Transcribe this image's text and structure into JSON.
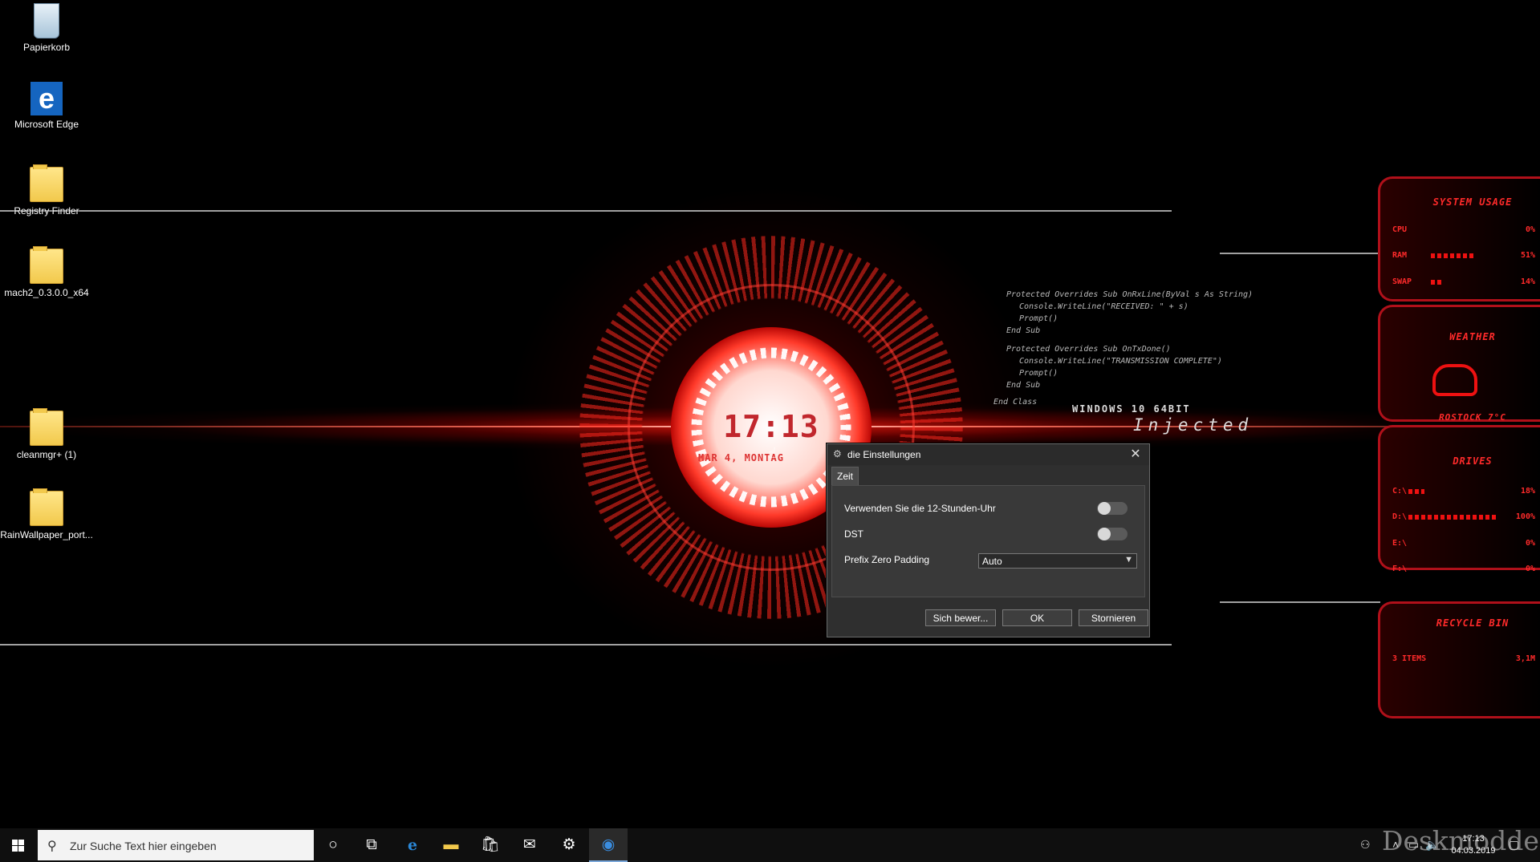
{
  "desktop": {
    "icons": [
      {
        "label": "Papierkorb"
      },
      {
        "label": "Microsoft Edge"
      },
      {
        "label": "Registry Finder"
      },
      {
        "label": "mach2_0.3.0.0_x64"
      },
      {
        "label": "cleanmgr+ (1)"
      },
      {
        "label": "RainWallpaper_port..."
      }
    ]
  },
  "wallpaper": {
    "clock_time": "17:13",
    "clock_date": "MAR 4, MONTAG",
    "os_label": "WINDOWS 10 64BIT",
    "os_sub": "Injected",
    "code_lines": [
      "Protected Overrides Sub OnRxLine(ByVal s As String)",
      "Console.WriteLine(\"RECEIVED: \" + s)",
      "Prompt()",
      "End Sub",
      "Protected Overrides Sub OnTxDone()",
      "Console.WriteLine(\"TRANSMISSION COMPLETE\")",
      "Prompt()",
      "End Sub",
      "End Class"
    ]
  },
  "rainmeter": {
    "system_title": "SYSTEM USAGE",
    "cpu_label": "CPU",
    "cpu_value": "0%",
    "ram_label": "RAM",
    "ram_value": "51%",
    "ram_fraction": 0.51,
    "swap_label": "SWAP",
    "swap_value": "14%",
    "swap_fraction": 0.14,
    "weather_title": "WEATHER",
    "weather_city": "ROSTOCK 7°C",
    "drives_title": "DRIVES",
    "drives": [
      {
        "label": "C:\\",
        "value": "18%",
        "fraction": 0.18
      },
      {
        "label": "D:\\",
        "value": "100%",
        "fraction": 1.0
      },
      {
        "label": "E:\\",
        "value": "0%",
        "fraction": 0
      },
      {
        "label": "F:\\",
        "value": "0%",
        "fraction": 0
      }
    ],
    "recycle_title": "RECYCLE BIN",
    "recycle_items": "3 ITEMS",
    "recycle_size": "3,1M"
  },
  "dialog": {
    "title": "die Einstellungen",
    "tab": "Zeit",
    "option_12h": "Verwenden Sie die 12-Stunden-Uhr",
    "option_12h_on": false,
    "option_dst": "DST",
    "option_dst_on": false,
    "padding_label": "Prefix Zero Padding",
    "padding_value": "Auto",
    "btn_rate": "Sich bewer...",
    "btn_ok": "OK",
    "btn_cancel": "Stornieren"
  },
  "taskbar": {
    "search_placeholder": "Zur Suche Text hier eingeben",
    "clock_time": "17:13",
    "clock_date": "04.03.2019",
    "watermark": "Deskmodder.de"
  },
  "colors": {
    "accent": "#c1272d",
    "dialog_bg": "#2f2f2f",
    "taskbar_bg": "#0f0f0f"
  }
}
